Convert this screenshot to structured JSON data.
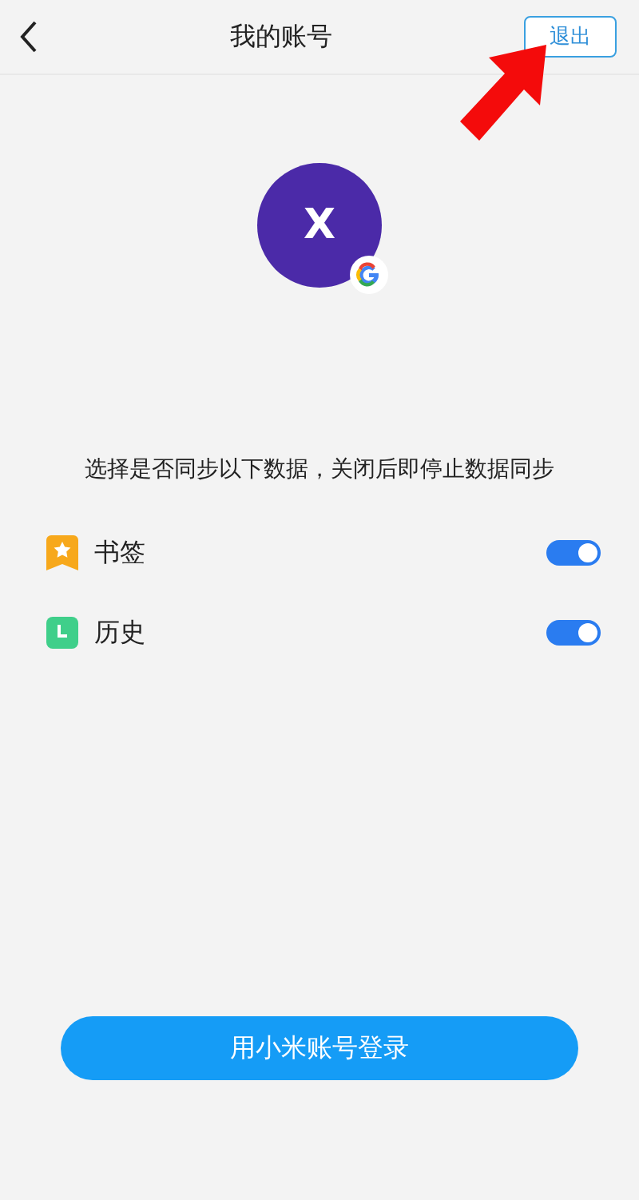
{
  "header": {
    "title": "我的账号",
    "logout_button": "退出"
  },
  "account": {
    "avatar_letter": "X"
  },
  "sync_note": "选择是否同步以下数据，关闭后即停止数据同步",
  "sync_items": [
    {
      "kind": "bookmark",
      "label": "书签",
      "on": true
    },
    {
      "kind": "history",
      "label": "历史",
      "on": true
    }
  ],
  "login_button": "用小米账号登录"
}
